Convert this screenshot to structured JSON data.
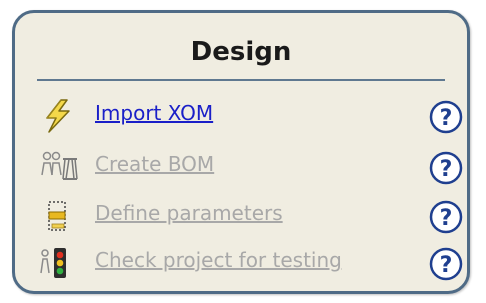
{
  "panel": {
    "title": "Design",
    "colors": {
      "background": "#f0ede1",
      "border": "#4f6b86",
      "link_active": "#1a1fc8",
      "link_disabled": "#a8a8a8",
      "help_icon": "#1f3f8f"
    },
    "items": [
      {
        "label": "Import XOM",
        "enabled": true,
        "icon": "lightning-icon"
      },
      {
        "label": "Create BOM",
        "enabled": false,
        "icon": "people-model-icon"
      },
      {
        "label": "Define parameters",
        "enabled": false,
        "icon": "parameters-icon"
      },
      {
        "label": "Check project for testing",
        "enabled": false,
        "icon": "traffic-light-icon"
      }
    ],
    "help_icon": "question-icon"
  }
}
